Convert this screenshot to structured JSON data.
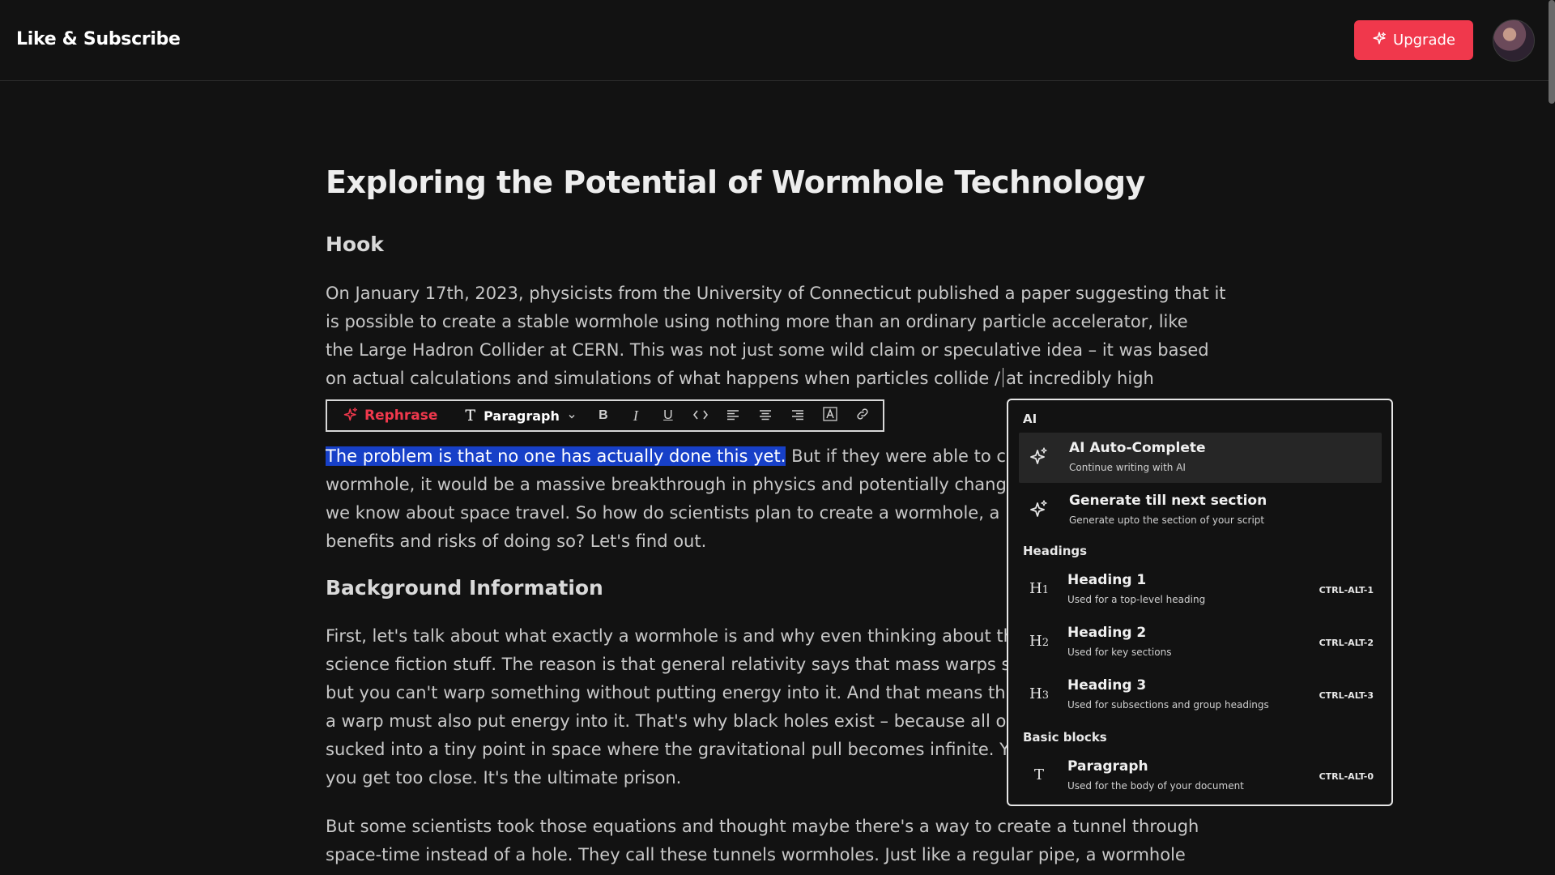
{
  "header": {
    "brand": "Like & Subscribe",
    "upgrade_label": "Upgrade",
    "accent_color": "#f0384c"
  },
  "doc": {
    "title": "Exploring the Potential of Wormhole Technology",
    "hook_heading": "Hook",
    "hook_lines": [
      "On January 17th, 2023, physicists from the University of Connecticut published a paper suggesting that it",
      "is possible to create a stable wormhole using nothing more than an ordinary particle accelerator, like",
      "the Large Hadron Collider at CERN. This was not just some wild claim or speculative idea – it was based"
    ],
    "hook_line4_before": "on actual calculations and simulations of what happens when particles collide /",
    "hook_line4_after": "at incredibly high",
    "selected_text": "The problem is that no one has actually done this yet.",
    "p2_line1_rest": " But if they were able to cr",
    "p2_lines": [
      "wormhole, it would be a massive breakthrough in physics and potentially chang",
      "we know about space travel. So how do scientists plan to create a wormhole, a",
      "benefits and risks of doing so? Let's find out."
    ],
    "background_heading": "Background Information",
    "bg_lines": [
      "First, let's talk about what exactly a wormhole is and why even thinking about th",
      "science fiction stuff. The reason is that general relativity says that mass warps s",
      "but you can't warp something without putting energy into it. And that means th",
      "a warp must also put energy into it. That's why black holes exist – because all o",
      "sucked into a tiny point in space where the gravitational pull becomes infinite. Y",
      "you get too close. It's the ultimate prison."
    ],
    "p4_lines": [
      "But some scientists took those equations and thought maybe there's a way to create a tunnel through",
      "space-time instead of a hole. They call these tunnels wormholes. Just like a regular pipe, a wormhole"
    ]
  },
  "toolbar": {
    "rephrase_label": "Rephrase",
    "block_type": "Paragraph",
    "buttons": [
      "bold-icon",
      "italic-icon",
      "underline-icon",
      "code-icon",
      "align-left-icon",
      "align-center-icon",
      "align-right-icon",
      "text-color-icon",
      "link-icon"
    ]
  },
  "slash_menu": {
    "sections": {
      "ai": "AI",
      "headings": "Headings",
      "basic": "Basic blocks"
    },
    "ai_items": [
      {
        "title": "AI Auto-Complete",
        "desc": "Continue writing with AI",
        "icon": "sparkle-icon"
      },
      {
        "title": "Generate till next section",
        "desc": "Generate upto the section of your script",
        "icon": "sparkle-icon"
      }
    ],
    "heading_items": [
      {
        "title": "Heading 1",
        "desc": "Used for a top-level heading",
        "shortcut": "CTRL-ALT-1",
        "icon": "H1"
      },
      {
        "title": "Heading 2",
        "desc": "Used for key sections",
        "shortcut": "CTRL-ALT-2",
        "icon": "H2"
      },
      {
        "title": "Heading 3",
        "desc": "Used for subsections and group headings",
        "shortcut": "CTRL-ALT-3",
        "icon": "H3"
      }
    ],
    "basic_items": [
      {
        "title": "Paragraph",
        "desc": "Used for the body of your document",
        "shortcut": "CTRL-ALT-0",
        "icon": "T"
      }
    ]
  }
}
